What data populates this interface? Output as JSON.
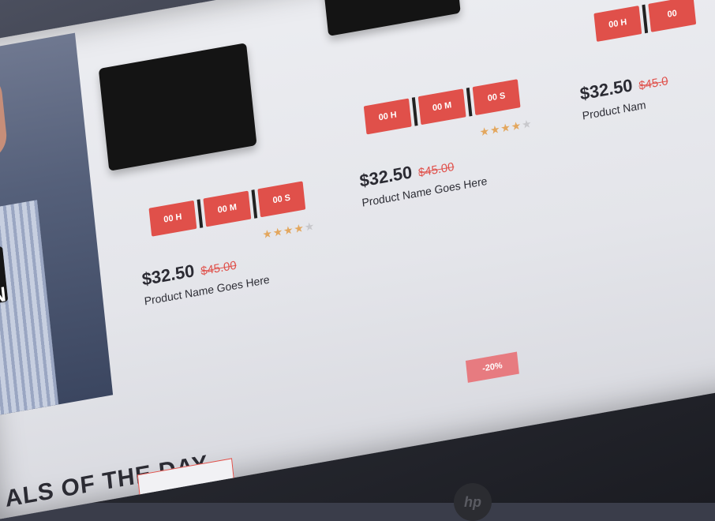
{
  "hero": {
    "text": "ION"
  },
  "products": [
    {
      "timer": {
        "hours": "00 H",
        "minutes": "00 M",
        "seconds": "00 S"
      },
      "price": "$32.50",
      "old_price": "$45.00",
      "name": "Product Name Goes Here",
      "rating": 4,
      "rating_max": 5
    },
    {
      "timer": {
        "hours": "00 H",
        "minutes": "00 M",
        "seconds": "00 S"
      },
      "price": "$32.50",
      "old_price": "$45.00",
      "name": "Product Name Goes Here",
      "rating": 4,
      "rating_max": 5
    },
    {
      "timer": {
        "hours": "00 H",
        "minutes": "00",
        "seconds": ""
      },
      "price": "$32.50",
      "old_price": "$45.0",
      "name": "Product Nam",
      "rating": 0,
      "rating_max": 0
    }
  ],
  "discount_badge": "-20%",
  "section_title": "ALS OF THE DAY",
  "icons": {
    "star": "star-icon",
    "brand": "hp-logo-icon"
  },
  "colors": {
    "accent": "#e0504a",
    "star": "#e3a75e",
    "badge": "#e77b80",
    "text": "#2b2b33"
  }
}
